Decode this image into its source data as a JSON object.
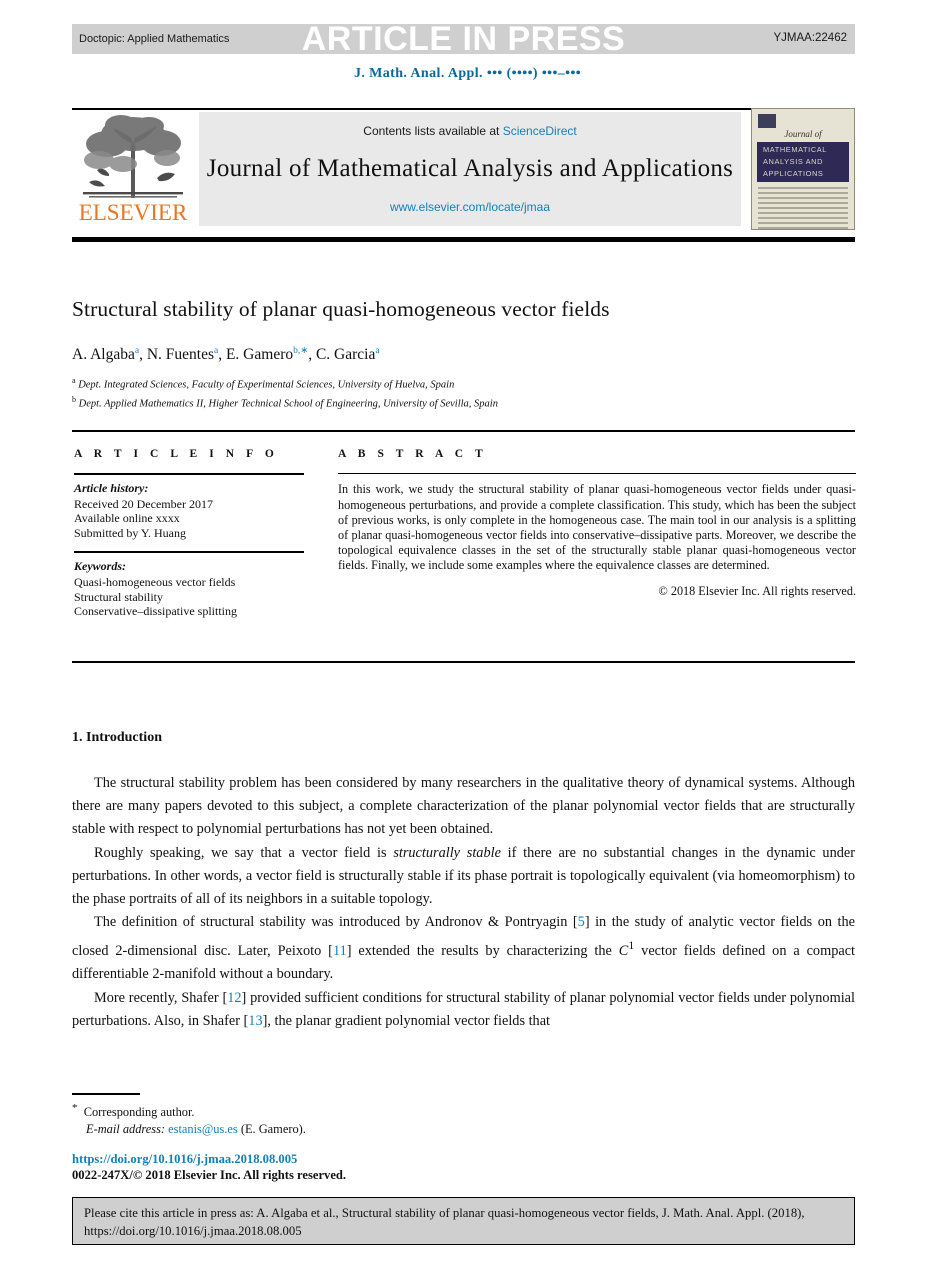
{
  "header": {
    "doctopic": "Doctopic:  Applied Mathematics",
    "article_in_press": "ARTICLE IN PRESS",
    "pii": "YJMAA:22462",
    "running_head": "J. Math. Anal. Appl. ••• (••••) •••–•••"
  },
  "masthead": {
    "contents_prefix": "Contents lists available at ",
    "sciencedirect": "ScienceDirect",
    "journal_title": "Journal of Mathematical Analysis and Applications",
    "journal_url": "www.elsevier.com/locate/jmaa",
    "publisher_wordmark": "ELSEVIER",
    "cover": {
      "journal_of": "Journal of",
      "band_line1": "MATHEMATICAL",
      "band_line2": "ANALYSIS AND",
      "band_line3": "APPLICATIONS"
    }
  },
  "article": {
    "title": "Structural stability of planar quasi-homogeneous vector fields",
    "authors": [
      {
        "name": "A. Algaba",
        "marks": "a"
      },
      {
        "name": "N. Fuentes",
        "marks": "a"
      },
      {
        "name": "E. Gamero",
        "marks": "b,∗"
      },
      {
        "name": "C. Garcia",
        "marks": "a"
      }
    ],
    "affiliations": [
      {
        "mark": "a",
        "text": "Dept. Integrated Sciences, Faculty of Experimental Sciences, University of Huelva, Spain"
      },
      {
        "mark": "b",
        "text": "Dept. Applied Mathematics II, Higher Technical School of Engineering, University of Sevilla, Spain"
      }
    ]
  },
  "info": {
    "heading": "A R T I C L E   I N F O",
    "history_label": "Article history:",
    "history": [
      "Received 20 December 2017",
      "Available online xxxx",
      "Submitted by Y. Huang"
    ],
    "keywords_label": "Keywords:",
    "keywords": [
      "Quasi-homogeneous vector fields",
      "Structural stability",
      "Conservative–dissipative splitting"
    ]
  },
  "abstract": {
    "heading": "A B S T R A C T",
    "text": "In this work, we study the structural stability of planar quasi-homogeneous vector fields under quasi-homogeneous perturbations, and provide a complete classification. This study, which has been the subject of previous works, is only complete in the homogeneous case. The main tool in our analysis is a splitting of planar quasi-homogeneous vector fields into conservative–dissipative parts. Moreover, we describe the topological equivalence classes in the set of the structurally stable planar quasi-homogeneous vector fields. Finally, we include some examples where the equivalence classes are determined.",
    "copyright": "© 2018 Elsevier Inc. All rights reserved."
  },
  "section": {
    "number_title": "1.  Introduction",
    "paragraphs": [
      {
        "parts": [
          {
            "t": "The structural stability problem has been considered by many researchers in the qualitative theory of dynamical systems. Although there are many papers devoted to this subject, a complete characterization of the planar polynomial vector fields that are structurally stable with respect to polynomial perturbations has not yet been obtained."
          }
        ]
      },
      {
        "parts": [
          {
            "t": "Roughly speaking, we say that a vector field is "
          },
          {
            "t": "structurally stable",
            "s": "i"
          },
          {
            "t": " if there are no substantial changes in the dynamic under perturbations. In other words, a vector field is structurally stable if its phase portrait is topologically equivalent (via homeomorphism) to the phase portraits of all of its neighbors in a suitable topology."
          }
        ]
      },
      {
        "parts": [
          {
            "t": "The definition of structural stability was introduced by Andronov & Pontryagin ["
          },
          {
            "t": "5",
            "s": "ref"
          },
          {
            "t": "] in the study of analytic vector fields on the closed 2-dimensional disc. Later, Peixoto ["
          },
          {
            "t": "11",
            "s": "ref"
          },
          {
            "t": "] extended the results by characterizing the "
          },
          {
            "t": "C",
            "s": "i"
          },
          {
            "t": "1",
            "s": "sup"
          },
          {
            "t": " vector fields defined on a compact differentiable 2-manifold without a boundary."
          }
        ]
      },
      {
        "parts": [
          {
            "t": "More recently, Shafer ["
          },
          {
            "t": "12",
            "s": "ref"
          },
          {
            "t": "] provided sufficient conditions for structural stability of planar polynomial vector fields under polynomial perturbations. Also, in Shafer ["
          },
          {
            "t": "13",
            "s": "ref"
          },
          {
            "t": "], the planar gradient polynomial vector fields that"
          }
        ]
      }
    ]
  },
  "footer": {
    "corresponding_mark": "*",
    "corresponding_text": "Corresponding author.",
    "email_label": "E-mail address:",
    "email": "estanis@us.es",
    "email_owner": "(E. Gamero).",
    "doi": "https://doi.org/10.1016/j.jmaa.2018.08.005",
    "issn_copyright": "0022-247X/© 2018 Elsevier Inc. All rights reserved.",
    "cite_box": "Please cite this article in press as: A. Algaba et al., Structural stability of planar quasi-homogeneous vector fields, J. Math. Anal. Appl. (2018), https://doi.org/10.1016/j.jmaa.2018.08.005"
  },
  "colors": {
    "band_gray": "#cfcfcf",
    "link_blue": "#1580b8",
    "heading_blue": "#0b6898",
    "elsevier_orange": "#e87722",
    "masthead_gray": "#e9e9e9"
  }
}
